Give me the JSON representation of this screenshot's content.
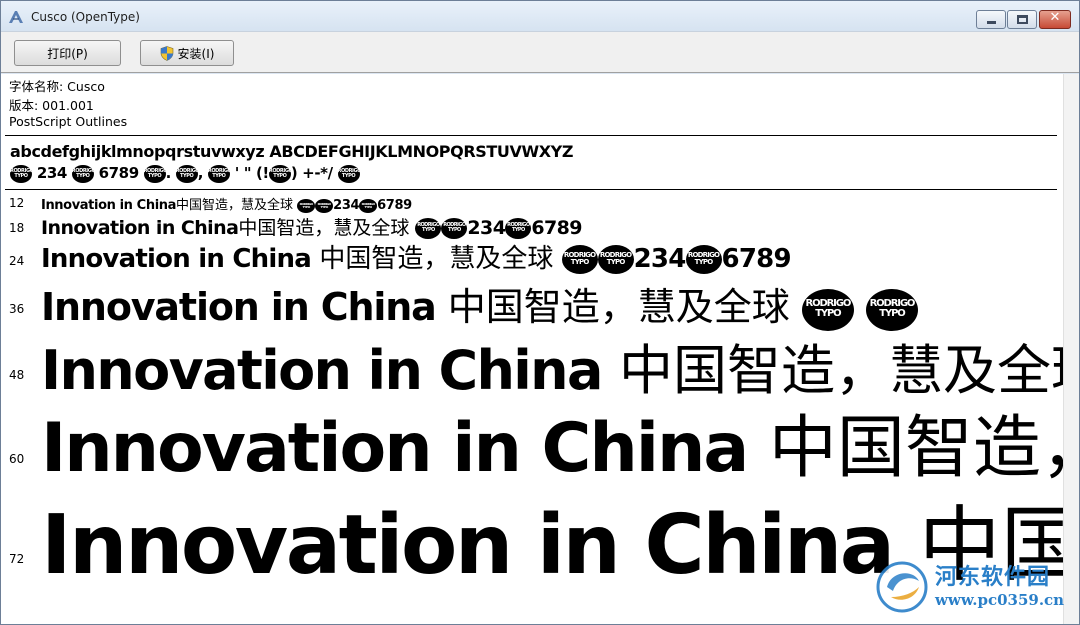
{
  "window": {
    "title": "Cusco (OpenType)"
  },
  "toolbar": {
    "print_label": "打印(P)",
    "install_label": "安装(I)"
  },
  "info": {
    "font_name": "字体名称: Cusco",
    "version": "版本: 001.001",
    "outlines": "PostScript Outlines"
  },
  "charset": {
    "letters": "abcdefghijklmnopqrstuvwxyz ABCDEFGHIJKLMNOPQRSTUVWXYZ",
    "digits_234": "234",
    "digits_6789": "6789",
    "punct_1": ".",
    "punct_2": ",",
    "punct_3": "' \"",
    "punct_4": "(!",
    "punct_5": ")",
    "punct_6": "+-*/",
    "punct_7": ")"
  },
  "samples": {
    "latin": "Innovation in China",
    "cjk": "中国智造，慧及全球",
    "digits_a": "234",
    "digits_b": "6789",
    "badge_text": "RODRIGO TYPO",
    "rows": [
      {
        "size": "12"
      },
      {
        "size": "18"
      },
      {
        "size": "24"
      },
      {
        "size": "36"
      },
      {
        "size": "48"
      },
      {
        "size": "60"
      },
      {
        "size": "72"
      }
    ]
  },
  "watermark": {
    "name": "河东软件园",
    "url": "www.pc0359.cn"
  },
  "colors": {
    "titlebar": "#d6e3f1",
    "close_button": "#c74a35",
    "watermark_blue": "#2a7fc8"
  }
}
